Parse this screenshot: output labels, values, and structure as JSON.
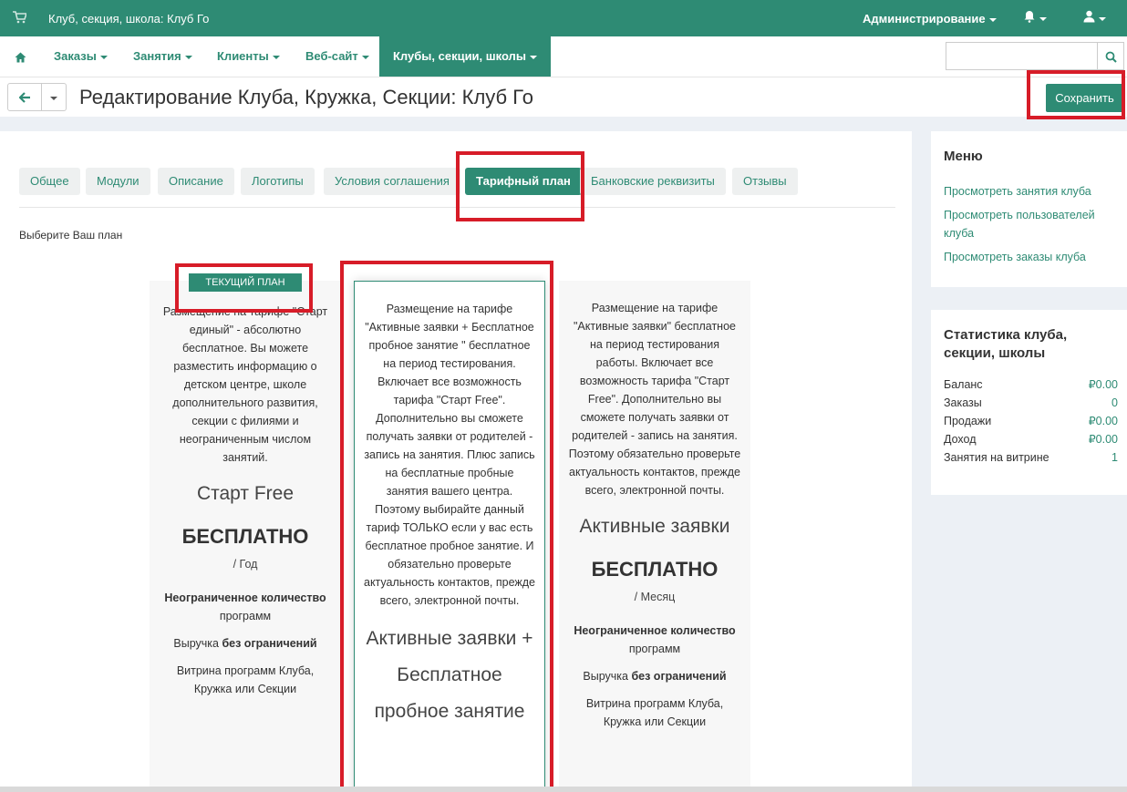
{
  "topbar": {
    "cart_icon": "shopping-cart-icon",
    "brand": "Клуб, секция, школа: Клуб Го",
    "admin": "Администрирование",
    "bell_icon": "bell-icon",
    "user_icon": "user-icon"
  },
  "nav": {
    "home_icon": "home-icon",
    "items": [
      "Заказы",
      "Занятия",
      "Клиенты",
      "Веб-сайт",
      "Клубы, секции, школы"
    ],
    "active_index": 4,
    "search_icon": "search-icon",
    "search_placeholder": ""
  },
  "header": {
    "back_icon": "arrow-left-icon",
    "title": "Редактирование Клуба, Кружка, Секции: Клуб Го",
    "save": "Сохранить"
  },
  "tabs": {
    "items": [
      "Общее",
      "Модули",
      "Описание",
      "Логотипы",
      "Условия соглашения",
      "Тарифный план",
      "Банковские реквизиты",
      "Отзывы"
    ],
    "active_index": 5
  },
  "choose_label": "Выберите Ваш план",
  "plans": [
    {
      "badge": "ТЕКУЩИЙ ПЛАН",
      "desc": "Размещение на тарифе \"Старт единый\" - абсолютно бесплатное. Вы можете разместить информацию о детском центре, школе дополнительного развития, секции с филиями и неограниченным числом занятий.",
      "name": "Старт Free",
      "price": "БЕСПЛАТНО",
      "period": "/ Год",
      "feat1_bold": "Неограниченное количество",
      "feat1_rest": " программ",
      "feat2_pre": "Выручка ",
      "feat2_bold": "без ограничений",
      "feat3": "Витрина программ Клуба, Кружка или Секции"
    },
    {
      "desc": "Размещение на тарифе \"Активные заявки + Бесплатное пробное занятие \" бесплатное на период тестирования. Включает все возможность тарифа \"Старт Free\". Дополнительно вы сможете получать заявки от родителей - запись на занятия. Плюс запись на бесплатные пробные занятия вашего центра. Поэтому выбирайте данный тариф ТОЛЬКО если у вас есть бесплатное пробное занятие. И обязательно проверьте актуальность контактов, прежде всего, электронной почты.",
      "name": "Активные заявки + Бесплатное пробное занятие"
    },
    {
      "desc": "Размещение на тарифе \"Активные заявки\" бесплатное на период тестирования работы. Включает все возможность тарифа \"Старт Free\". Дополнительно вы сможете получать заявки от родителей - запись на занятия. Поэтому обязательно проверьте актуальность контактов, прежде всего, электронной почты.",
      "name": "Активные заявки",
      "price": "БЕСПЛАТНО",
      "period": "/ Месяц",
      "feat1_bold": "Неограниченное количество",
      "feat1_rest": " программ",
      "feat2_pre": "Выручка ",
      "feat2_bold": "без ограничений",
      "feat3": "Витрина программ Клуба, Кружка или Секции"
    }
  ],
  "menu": {
    "title": "Меню",
    "links": [
      "Просмотреть занятия клуба",
      "Просмотреть пользователей клуба",
      "Просмотреть заказы клуба"
    ]
  },
  "stats": {
    "title": "Статистика клуба, секции, школы",
    "rows": [
      {
        "label": "Баланс",
        "value": "₽0.00"
      },
      {
        "label": "Заказы",
        "value": "0"
      },
      {
        "label": "Продажи",
        "value": "₽0.00"
      },
      {
        "label": "Доход",
        "value": "₽0.00"
      },
      {
        "label": "Занятия на витрине",
        "value": "1"
      }
    ]
  },
  "colors": {
    "accent": "#2e8b74",
    "highlight": "#d71c28"
  }
}
